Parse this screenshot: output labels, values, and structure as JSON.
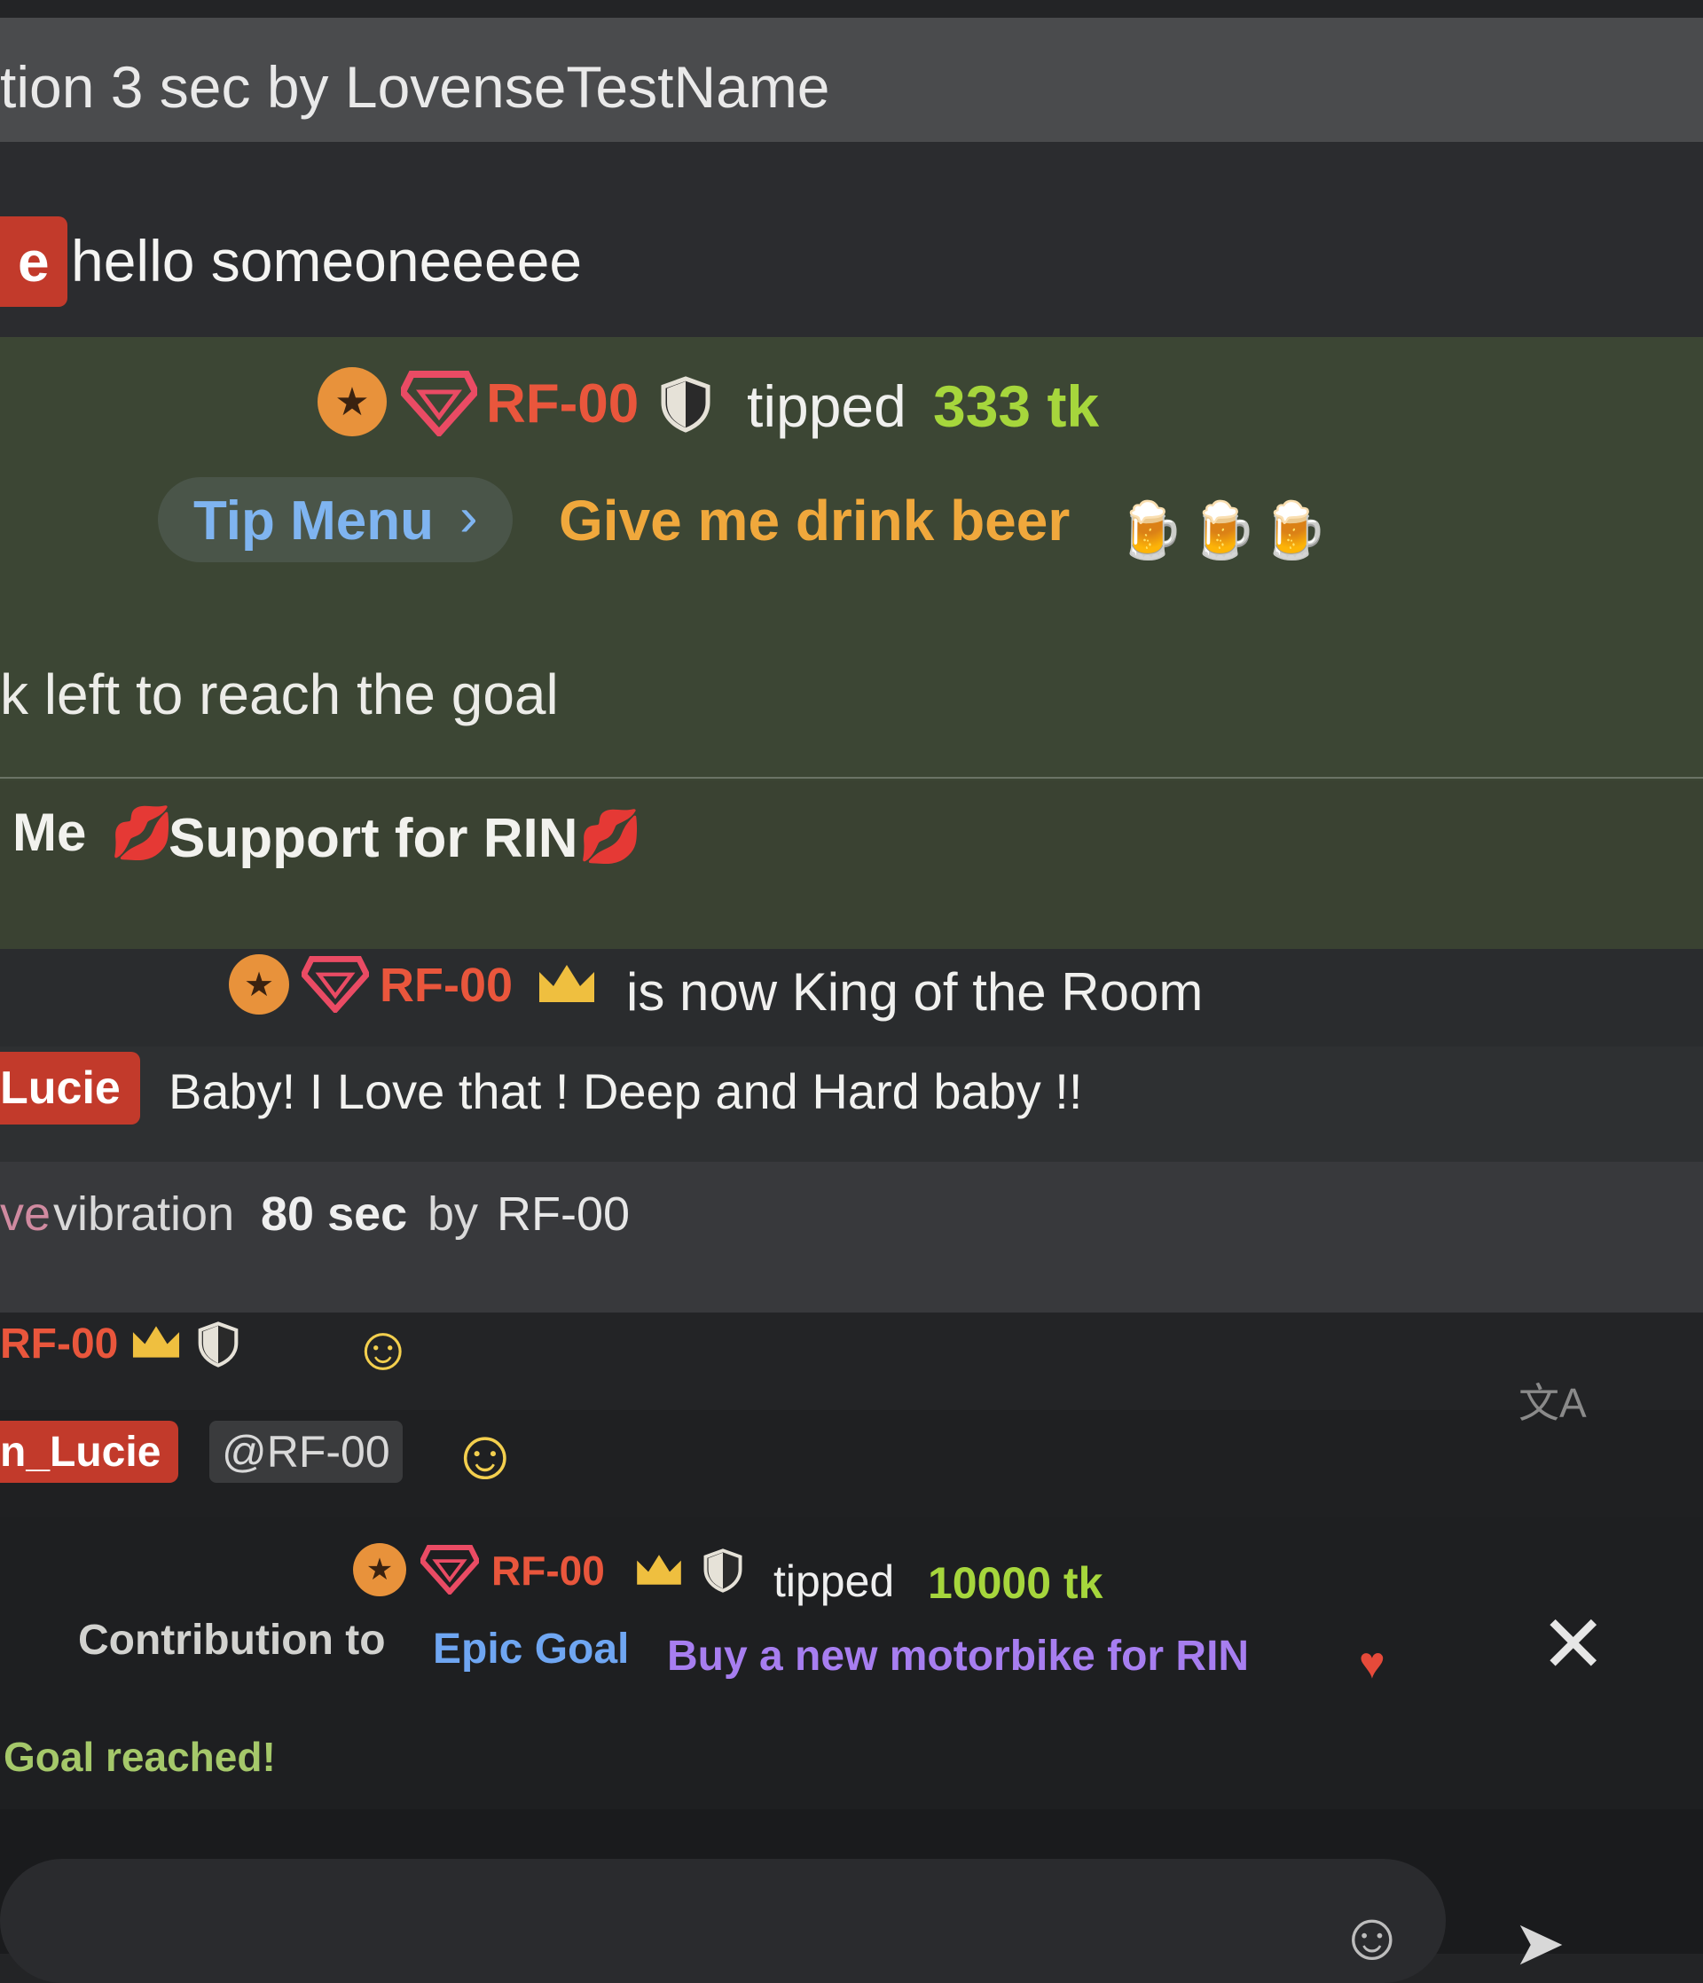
{
  "chat": {
    "row_vibration_top": {
      "text": "tion 3 sec by LovenseTestName"
    },
    "row_hello": {
      "user_tag": "e",
      "message": "hello someoneeeee"
    },
    "row_tip1": {
      "user": "RF-00",
      "action": "tipped",
      "amount": "333 tk"
    },
    "row_tipmenu": {
      "button": "Tip Menu",
      "item": "Give me drink beer",
      "emoji": "beer-mug-icon"
    },
    "row_goal": {
      "text": "k left to reach the goal"
    },
    "row_support": {
      "prefix": "Me",
      "text": "Support for RIN",
      "emoji": "kiss-mark-icon"
    },
    "row_king": {
      "user": "RF-00",
      "text": "is now King of the Room"
    },
    "row_lucie": {
      "user_tag": "Lucie",
      "message": "Baby! I Love that ! Deep and Hard baby !!"
    },
    "row_vibration2": {
      "prefix": "ve",
      "text_a": "vibration",
      "duration": "80 sec",
      "text_b": "by",
      "user": "RF-00"
    },
    "row_rf_emoji": {
      "user": "RF-00"
    },
    "row_lucie2": {
      "user_tag": "n_Lucie",
      "mention": "@RF-00"
    },
    "row_tip2": {
      "user": "RF-00",
      "action": "tipped",
      "amount": "10000 tk"
    },
    "row_contribution": {
      "prefix": "Contribution to",
      "goal_a": "Epic Goal",
      "goal_b": "Buy a new motorbike for RIN"
    },
    "row_reached": {
      "text": "Goal reached!"
    }
  },
  "colors": {
    "username": "#e9563c",
    "tokens": "#a6d63c",
    "tip_item": "#f0a83c",
    "tip_menu_text": "#7fb4f0",
    "goal_blue": "#6fa6f2",
    "goal_purple": "#a77ef0"
  },
  "icons": [
    "star-badge-icon",
    "diamond-icon",
    "shield-icon",
    "crown-icon",
    "translate-icon",
    "close-icon",
    "smiley-icon",
    "send-icon",
    "heart-icon"
  ]
}
